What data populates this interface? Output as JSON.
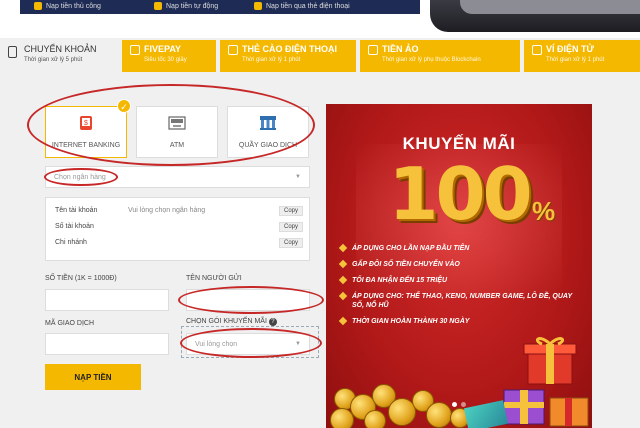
{
  "top_banner": {
    "items": [
      "Nạp tiền thủ công",
      "Nạp tiền tự động",
      "Nạp tiền qua thẻ điện thoại"
    ]
  },
  "tabs": [
    {
      "title": "CHUYỂN KHOẢN",
      "subtitle": "Thời gian xử lý 5 phút",
      "active": true
    },
    {
      "title": "FIVEPAY",
      "subtitle": "Siêu tốc 30 giây",
      "active": false
    },
    {
      "title": "THẺ CÀO ĐIỆN THOẠI",
      "subtitle": "Thời gian xử lý 1 phút",
      "active": false
    },
    {
      "title": "TIỀN ẢO",
      "subtitle": "Thời gian xử lý phụ thuộc Blockchain",
      "active": false
    },
    {
      "title": "VÍ ĐIỆN TỬ",
      "subtitle": "Thời gian xử lý 1 phút",
      "active": false
    }
  ],
  "methods": [
    {
      "label": "INTERNET BANKING",
      "icon": "internet-banking-icon",
      "selected": true
    },
    {
      "label": "ATM",
      "icon": "atm-icon",
      "selected": false
    },
    {
      "label": "QUẦY GIAO DỊCH",
      "icon": "bank-counter-icon",
      "selected": false
    }
  ],
  "bank_select": {
    "placeholder": "Chọn ngân hàng"
  },
  "account_info": {
    "rows": [
      {
        "label": "Tên tài khoản",
        "value": "Vui lòng chọn ngân hàng",
        "copy": "Copy"
      },
      {
        "label": "Số tài khoản",
        "value": "",
        "copy": "Copy"
      },
      {
        "label": "Chi nhánh",
        "value": "",
        "copy": "Copy"
      }
    ]
  },
  "form": {
    "amount_label": "SỐ TIỀN (1K = 1000Đ)",
    "amount_value": "",
    "sender_label": "TÊN NGƯỜI GỬI",
    "sender_value": "",
    "txn_label": "MÃ GIAO DỊCH",
    "txn_value": "",
    "promo_label": "CHỌN GÓI KHUYẾN MÃI",
    "promo_placeholder": "Vui lòng chọn",
    "submit_label": "NẠP TIỀN"
  },
  "promo_banner": {
    "title": "KHUYẾN MÃI",
    "big_number": "100",
    "percent": "%",
    "bullets": [
      "ÁP DỤNG CHO LẦN NẠP ĐẦU TIÊN",
      "GẤP ĐÔI SỐ TIỀN CHUYỂN VÀO",
      "TỐI ĐA NHẬN ĐẾN 15 TRIỆU",
      "ÁP DỤNG CHO: THỂ THAO, KENO, NUMBER GAME, LÔ ĐỀ, QUAY SỐ, NỔ HŨ",
      "THỜI GIAN HOÀN THÀNH 30 NGÀY"
    ]
  },
  "colors": {
    "accent": "#f5b800",
    "annotation": "#c62828",
    "promo_red": "#c11f1f",
    "promo_gold": "#f7c23b"
  }
}
